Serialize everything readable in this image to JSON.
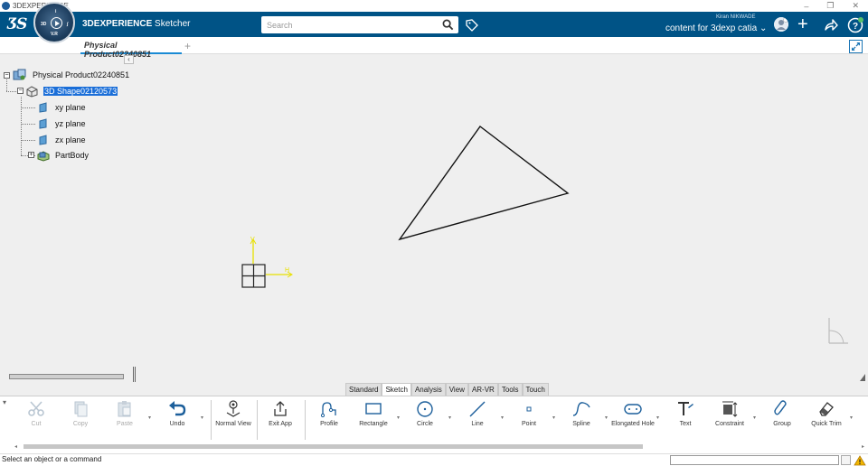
{
  "window": {
    "title": "3DEXPERIENCE",
    "minimize": "–",
    "restore": "❐",
    "close": "✕"
  },
  "app": {
    "brand_bold": "3DEXPERIENCE",
    "brand_app": " Sketcher",
    "compass": {
      "q1": "3D",
      "q2": "i",
      "q3": "∫",
      "q4": "$",
      "vr": "V.R"
    },
    "search": {
      "placeholder": "Search",
      "value": ""
    },
    "user_name": "Kiran NIKWADE",
    "tenant": "content for 3dexp catia",
    "tenant_chevron": "⌄",
    "add_symbol": "+"
  },
  "tabs": {
    "document": "Physical Product02240851",
    "add": "+"
  },
  "tree": {
    "collapse": "‹",
    "items": [
      {
        "label": "Physical Product02240851",
        "selected": false
      },
      {
        "label": "3D Shape02120573",
        "selected": true
      },
      {
        "label": "xy plane",
        "selected": false
      },
      {
        "label": "yz plane",
        "selected": false
      },
      {
        "label": "zx plane",
        "selected": false
      },
      {
        "label": "PartBody",
        "selected": false
      }
    ]
  },
  "axis_labels": {
    "v": "V",
    "h": "H"
  },
  "action_bar": {
    "tabs": [
      "Standard",
      "Sketch",
      "Analysis",
      "View",
      "AR-VR",
      "Tools",
      "Touch"
    ],
    "active_tab": "Sketch",
    "commands": {
      "cut": "Cut",
      "copy": "Copy",
      "paste": "Paste",
      "undo": "Undo",
      "normal_view": "Normal View",
      "exit_app": "Exit App",
      "profile": "Profile",
      "rectangle": "Rectangle",
      "circle": "Circle",
      "line": "Line",
      "point": "Point",
      "spline": "Spline",
      "elongated_hole": "Elongated Hole",
      "text": "Text",
      "constraint": "Constraint",
      "group": "Group",
      "quick_trim": "Quick Trim"
    },
    "dropdown_glyph": "▾",
    "scroll_left": "◂",
    "scroll_right": "▸"
  },
  "status": {
    "message": "Select an object or a command",
    "input_value": ""
  },
  "colors": {
    "brand_blue": "#005386",
    "selection": "#1a6ed8",
    "axis_yellow": "#e8e000",
    "tab_underline": "#1a8ad4"
  }
}
